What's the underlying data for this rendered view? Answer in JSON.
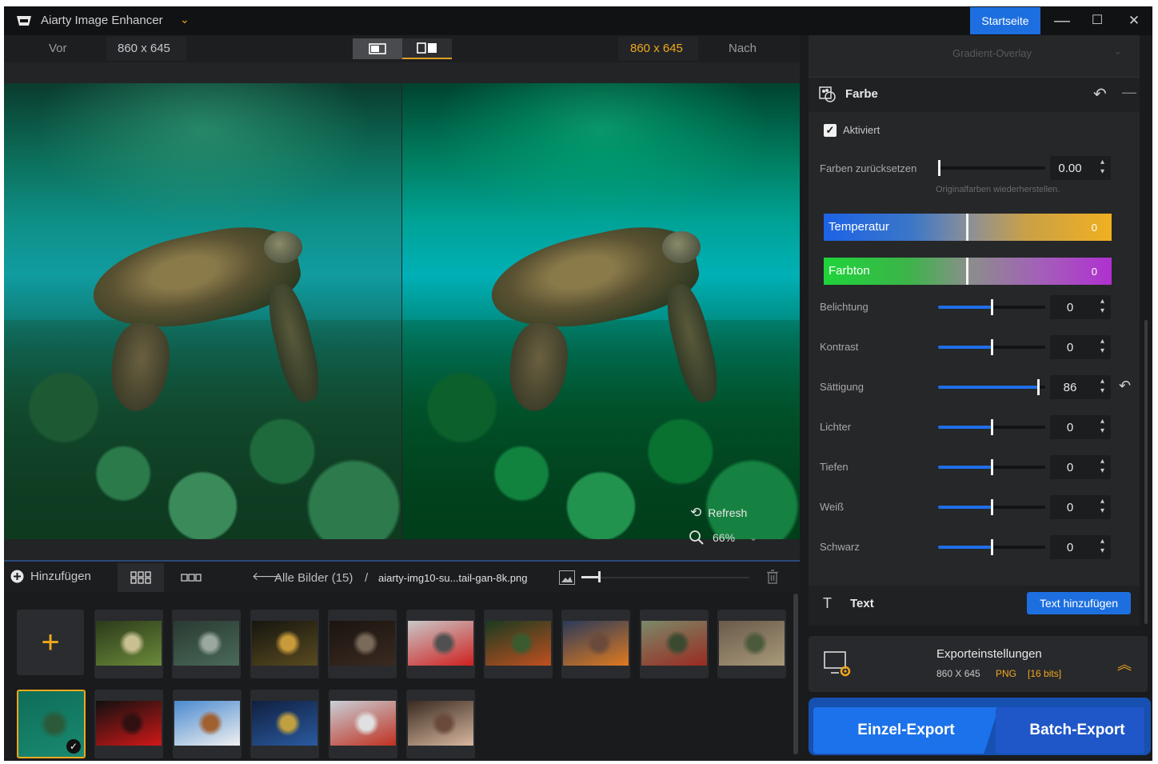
{
  "title_bar": {
    "app_title": "Aiarty Image Enhancer",
    "home_button": "Startseite",
    "minimize_symbol": "—",
    "maximize_symbol": "☐",
    "close_symbol": "✕"
  },
  "compare_bar": {
    "before_label": "Vor",
    "before_dimensions": "860 x 645",
    "after_dimensions": "860 x 645",
    "after_label": "Nach"
  },
  "preview": {
    "refresh_label": "Refresh",
    "zoom_value": "66%"
  },
  "right_panel": {
    "overlay_dropdown": "Gradient-Overlay",
    "color_section": {
      "title": "Farbe",
      "enabled_label": "Aktiviert",
      "enabled": true,
      "reset_colors": {
        "label": "Farben zurücksetzen",
        "value": "0.00",
        "level": 0,
        "hint": "Originalfarben wiederherstellen."
      },
      "temperature": {
        "label": "Temperatur",
        "value": "0",
        "level": 0.5
      },
      "tint": {
        "label": "Farbton",
        "value": "0",
        "level": 0.5
      },
      "sliders": [
        {
          "label": "Belichtung",
          "value": "0",
          "level": 0.5
        },
        {
          "label": "Kontrast",
          "value": "0",
          "level": 0.5
        },
        {
          "label": "Sättigung",
          "value": "86",
          "level": 0.93
        },
        {
          "label": "Lichter",
          "value": "0",
          "level": 0.5
        },
        {
          "label": "Tiefen",
          "value": "0",
          "level": 0.5
        },
        {
          "label": "Weiß",
          "value": "0",
          "level": 0.5
        },
        {
          "label": "Schwarz",
          "value": "0",
          "level": 0.5
        }
      ]
    },
    "text_section": {
      "title": "Text",
      "add_button": "Text hinzufügen"
    },
    "export_settings": {
      "title": "Exporteinstellungen",
      "dimensions": "860 X 645",
      "format": "PNG",
      "bits": "[16 bits]"
    },
    "single_export": "Einzel-Export",
    "batch_export": "Batch-Export"
  },
  "filmstrip": {
    "add_label": "Hinzufügen",
    "all_images": "Alle Bilder (15)",
    "separator": "/",
    "current_file": "aiarty-img10-su...tail-gan-8k.png",
    "thumbnail_size": 0.1,
    "thumbnails": [
      {
        "name": "thumb-forest-bird",
        "selected": false
      },
      {
        "name": "thumb-heron",
        "selected": false
      },
      {
        "name": "thumb-city-night",
        "selected": false
      },
      {
        "name": "thumb-dark-room",
        "selected": false
      },
      {
        "name": "thumb-red-flowers",
        "selected": false
      },
      {
        "name": "thumb-child",
        "selected": false
      },
      {
        "name": "thumb-sunset-lake",
        "selected": false
      },
      {
        "name": "thumb-red-car",
        "selected": false
      },
      {
        "name": "thumb-village",
        "selected": false
      },
      {
        "name": "thumb-sea-turtle",
        "selected": true
      },
      {
        "name": "thumb-red-rose",
        "selected": false
      },
      {
        "name": "thumb-white-house",
        "selected": false
      },
      {
        "name": "thumb-cat-blue",
        "selected": false
      },
      {
        "name": "thumb-red-train",
        "selected": false
      },
      {
        "name": "thumb-woman-portrait",
        "selected": false
      }
    ]
  },
  "colors": {
    "accent_blue": "#1d6fe0",
    "accent_orange": "#f0a81c",
    "background": "#1a1b1d"
  }
}
